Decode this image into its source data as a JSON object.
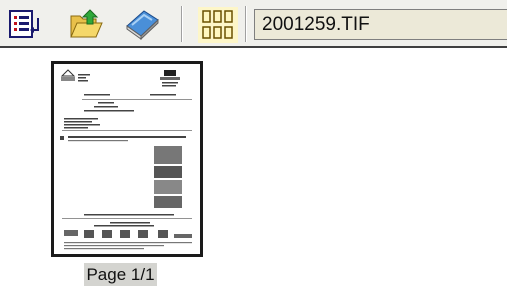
{
  "toolbar": {
    "buttons": [
      {
        "icon": "document-list-icon"
      },
      {
        "icon": "open-folder-icon"
      },
      {
        "icon": "book-icon"
      },
      {
        "icon": "thumbnail-grid-icon"
      }
    ],
    "filename": "2001259.TIF"
  },
  "thumbnail": {
    "page_label": "Page 1/1"
  }
}
